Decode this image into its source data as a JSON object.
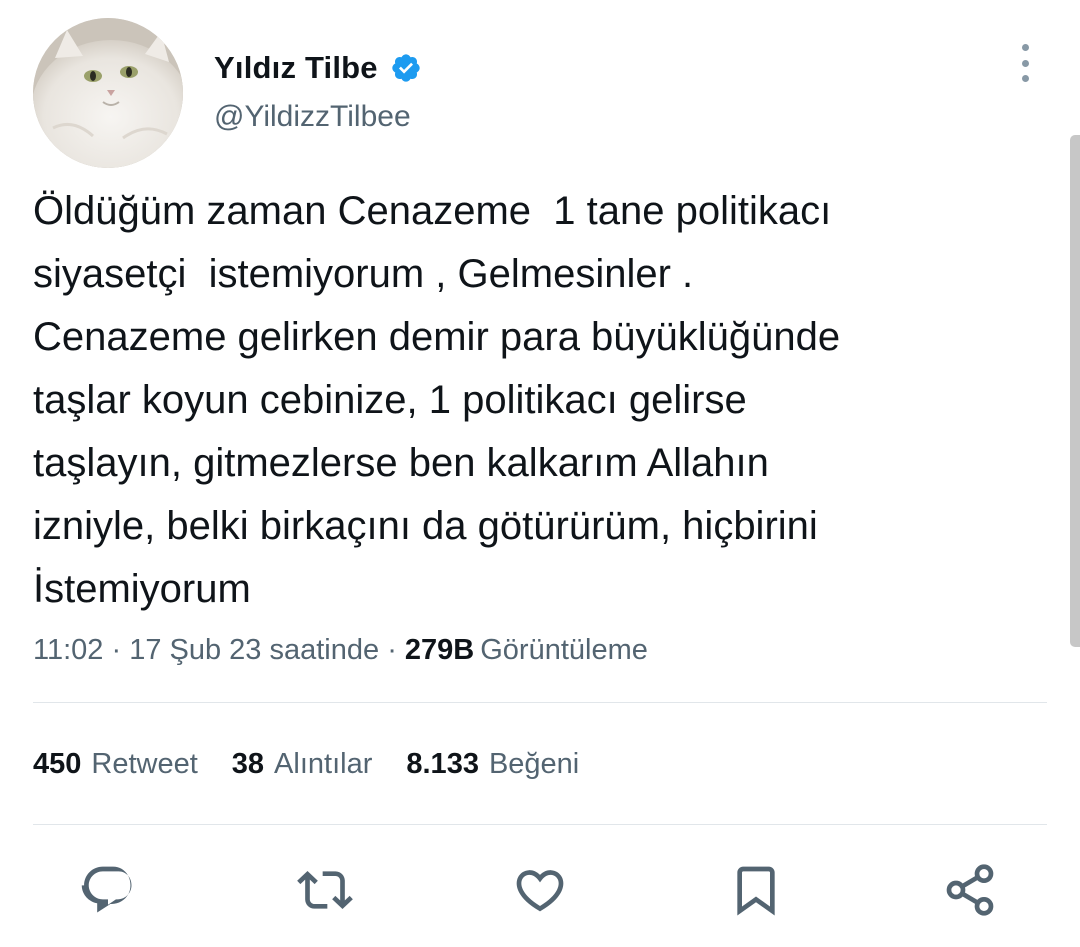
{
  "user": {
    "display_name": "Yıldız Tilbe",
    "handle": "@YildizzTilbee",
    "verified": true,
    "avatar_icon": "white-cat-avatar"
  },
  "tweet": {
    "text": "Öldüğüm zaman Cenazeme  1 tane politikacı\nsiyasetçi  istemiyorum , Gelmesinler .\nCenazeme gelirken demir para büyüklüğünde\ntaşlar koyun cebinize, 1 politikacı gelirse\ntaşlayın, gitmezlerse ben kalkarım Allahın\nizniyle, belki birkaçını da götürürüm, hiçbirini\nİstemiyorum",
    "time": "11:02",
    "date": "17 Şub 23 saatinde",
    "separator": " · ",
    "views_count": "279B",
    "views_label": "Görüntüleme"
  },
  "stats": {
    "retweets": {
      "count": "450",
      "label": "Retweet"
    },
    "quotes": {
      "count": "38",
      "label": "Alıntılar"
    },
    "likes": {
      "count": "8.133",
      "label": "Beğeni"
    }
  },
  "actions": [
    {
      "icon": "reply-icon"
    },
    {
      "icon": "retweet-icon"
    },
    {
      "icon": "like-heart-icon"
    },
    {
      "icon": "bookmark-icon"
    },
    {
      "icon": "share-icon"
    }
  ],
  "colors": {
    "text_primary": "#0f1419",
    "text_secondary": "#536471",
    "verified_blue": "#1d9bf0",
    "divider": "#e1e6ea",
    "icon": "#536471"
  }
}
